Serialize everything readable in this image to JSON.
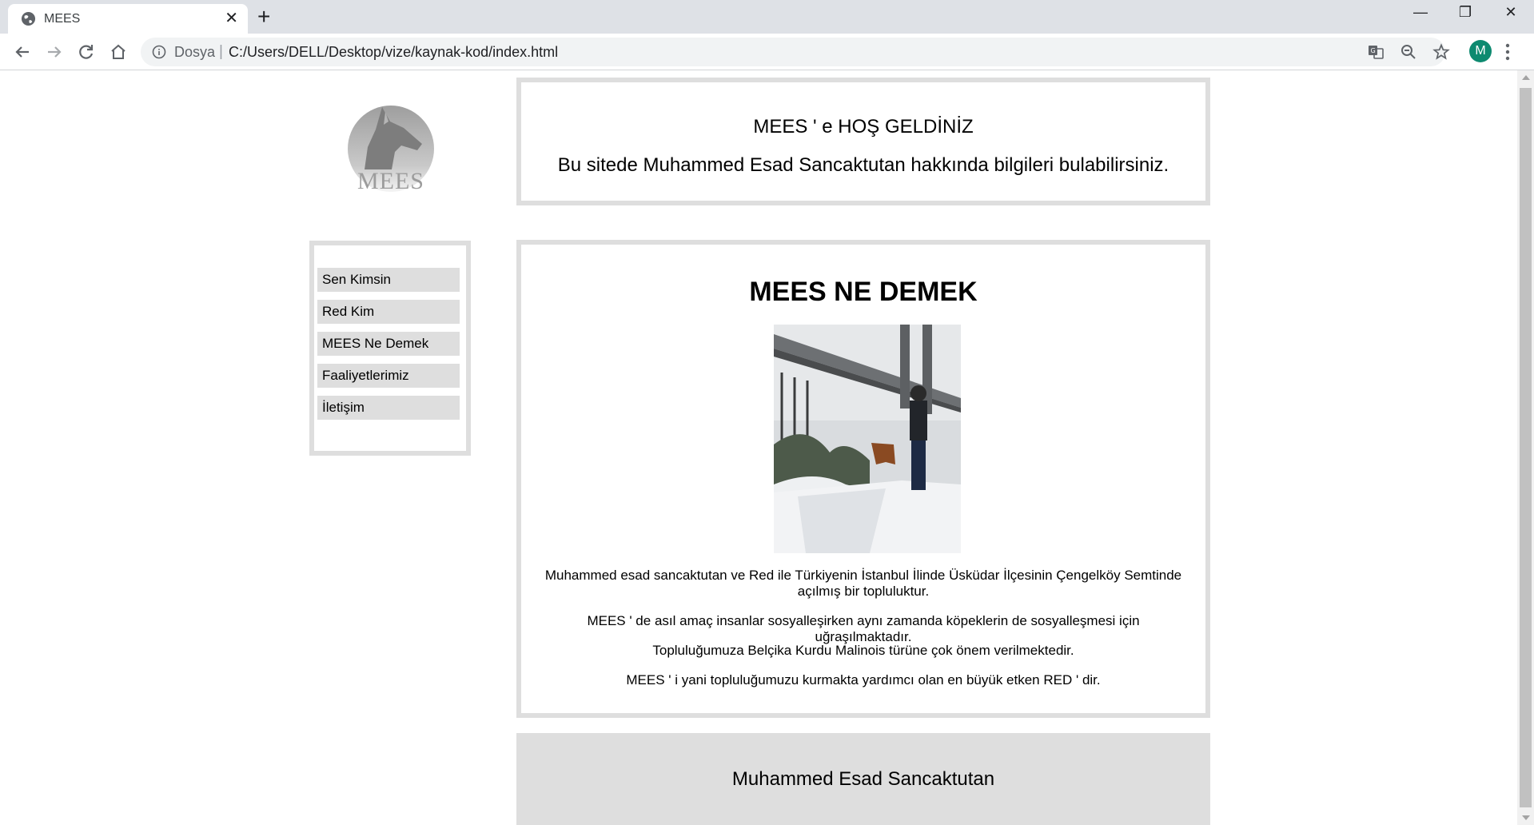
{
  "browser": {
    "tab_title": "MEES",
    "tab_close": "✕",
    "new_tab": "+",
    "window_controls": {
      "minimize": "—",
      "restore": "❐",
      "close": "✕"
    },
    "address_scheme_label": "Dosya",
    "address_separator": "|",
    "url": "C:/Users/DELL/Desktop/vize/kaynak-kod/index.html",
    "profile_initial": "M",
    "profile_color": "#0e8a70"
  },
  "page": {
    "logo_text": "MEES",
    "header": {
      "title": "MEES ' e HOŞ GELDİNİZ",
      "subtitle": "Bu sitede Muhammed Esad Sancaktutan hakkında bilgileri bulabilirsiniz."
    },
    "nav": {
      "items": [
        {
          "label": "Sen Kimsin"
        },
        {
          "label": "Red Kim"
        },
        {
          "label": "MEES Ne Demek"
        },
        {
          "label": "Faaliyetlerimiz"
        },
        {
          "label": "İletişim"
        }
      ]
    },
    "content": {
      "title": "MEES NE DEMEK",
      "paragraphs": [
        "Muhammed esad sancaktutan ve Red ile Türkiyenin İstanbul İlinde Üsküdar İlçesinin Çengelköy Semtinde açılmış bir topluluktur.",
        "MEES ' de asıl amaç insanlar sosyalleşirken aynı zamanda köpeklerin de sosyalleşmesi için uğraşılmaktadır.",
        "Topluluğumuza Belçika Kurdu Malinois türüne çok önem verilmektedir.",
        "MEES ' i yani topluluğumuzu kurmakta yardımcı olan en büyük etken RED ' dir."
      ]
    },
    "footer": {
      "text": "Muhammed Esad Sancaktutan"
    },
    "colors": {
      "box_border": "#dedede",
      "nav_item_bg": "#dedede",
      "footer_bg": "#dedede"
    }
  }
}
